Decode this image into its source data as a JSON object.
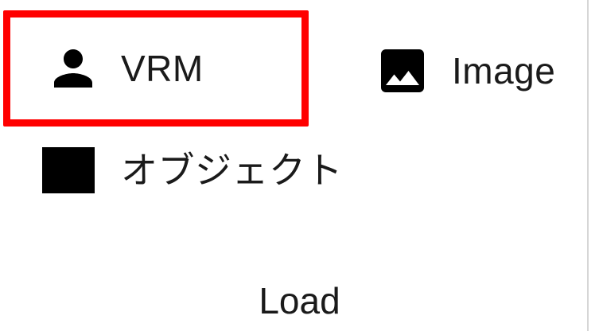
{
  "ribbon_group": {
    "label": "Load",
    "items": [
      {
        "label": "VRM",
        "icon": "person-icon",
        "highlighted": true
      },
      {
        "label": "Image",
        "icon": "image-icon"
      },
      {
        "label": "オブジェクト",
        "icon": "square-icon"
      }
    ]
  },
  "colors": {
    "highlight": "#ff0000",
    "icon": "#000000",
    "text": "#1a1a1a",
    "divider": "#d6d6d6"
  }
}
